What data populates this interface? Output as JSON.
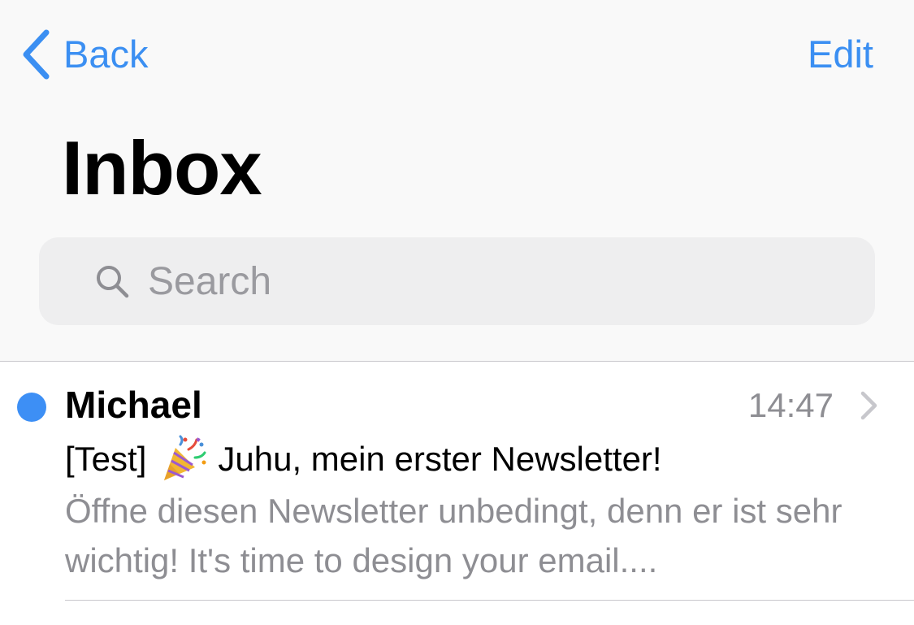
{
  "navbar": {
    "back_label": "Back",
    "edit_label": "Edit",
    "title": "Inbox"
  },
  "search": {
    "placeholder": "Search",
    "value": ""
  },
  "messages": [
    {
      "sender": "Michael",
      "time": "14:47",
      "subject_prefix": "[Test]",
      "subject_icon": "party-popper-icon",
      "subject_text": "Juhu, mein erster Newsletter!",
      "preview": "Öffne diesen Newsletter unbedingt, denn er ist sehr wichtig! It's time to design your email....",
      "unread": true
    }
  ],
  "colors": {
    "accent": "#3b8ff2",
    "unread_dot": "#3d8ff5",
    "nav_background": "#f9f9f9",
    "search_background": "#eeeeef",
    "secondary_text": "#8e8e93",
    "divider": "#c8c7cc"
  }
}
